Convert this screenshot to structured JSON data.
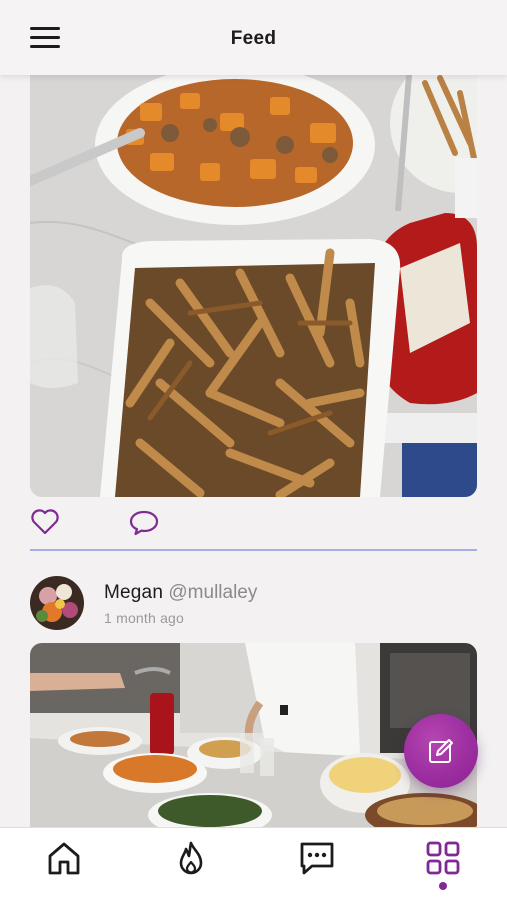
{
  "header": {
    "title": "Feed",
    "menu_icon": "hamburger-menu-icon"
  },
  "posts": [
    {
      "image_subject": "bowls of roasted vegetables and fries with ketchup",
      "actions": {
        "like_icon": "heart-icon",
        "comment_icon": "comment-icon"
      }
    },
    {
      "author_name": "Megan",
      "author_handle": "@mullaley",
      "time": "1 month ago",
      "image_subject": "kitchen counter with prepared dishes"
    }
  ],
  "fab": {
    "icon": "compose-icon",
    "color": "#9c2ea0"
  },
  "bottom_nav": {
    "items": [
      {
        "icon": "home-icon"
      },
      {
        "icon": "flame-icon"
      },
      {
        "icon": "chat-icon"
      },
      {
        "icon": "grid-icon",
        "active": true
      }
    ],
    "active_color": "#7e2a92"
  },
  "colors": {
    "accent": "#9c2ea0",
    "divider": "#a6aee0",
    "background": "#f3f1f2"
  }
}
